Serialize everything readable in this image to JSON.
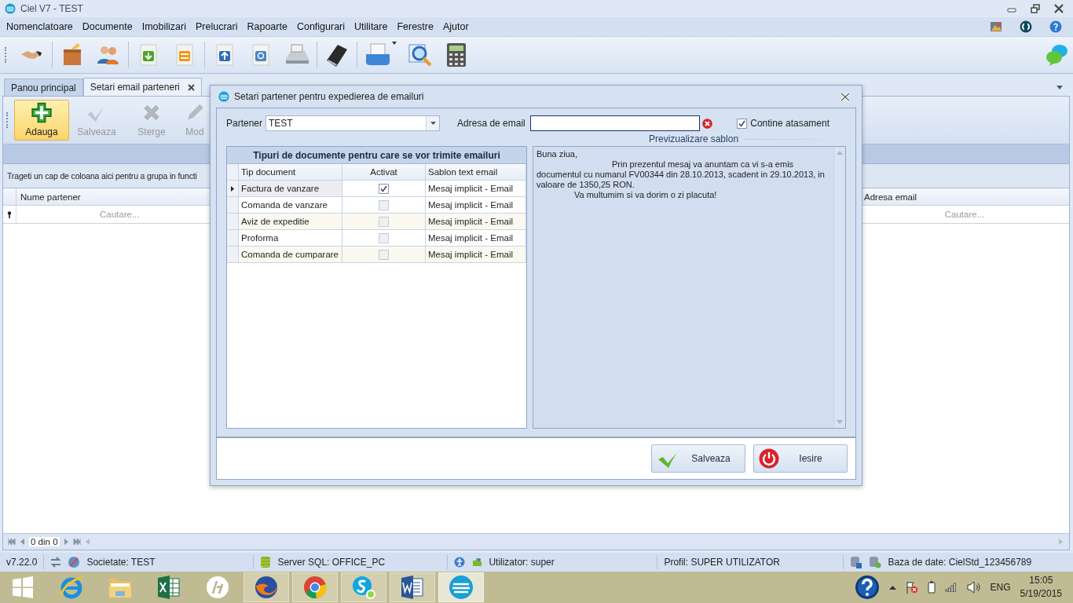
{
  "window": {
    "title": "Ciel V7 - TEST"
  },
  "menu": [
    "Nomenclatoare",
    "Documente",
    "Imobilizari",
    "Prelucrari",
    "Rapoarte",
    "Configurari",
    "Utilitare",
    "Ferestre",
    "Ajutor"
  ],
  "tabs": [
    {
      "label": "Panou principal",
      "selected": false
    },
    {
      "label": "Setari email parteneri",
      "selected": true
    }
  ],
  "ribbon": [
    {
      "label": "Adauga",
      "selected": true,
      "disabled": false
    },
    {
      "label": "Salveaza",
      "selected": false,
      "disabled": true
    },
    {
      "label": "Sterge",
      "selected": false,
      "disabled": true
    },
    {
      "label": "Mod",
      "selected": false,
      "disabled": true
    }
  ],
  "grid": {
    "group_hint": "Trageti un cap de coloana aici pentru a grupa in functi",
    "columns": [
      "Nume partener",
      "Adresa email"
    ],
    "filters": [
      "Cautare...",
      "Cautare..."
    ]
  },
  "pager": {
    "text": "0 din 0"
  },
  "dialog": {
    "title": "Setari partener pentru expedierea de emailuri",
    "partner": {
      "label": "Partener",
      "value": "TEST"
    },
    "email": {
      "label": "Adresa de email"
    },
    "attachment": {
      "label": "Contine atasament",
      "checked": true
    },
    "preview_label": "Previzualizare sablon",
    "table": {
      "title": "Tipuri de documente pentru care se vor trimite emailuri",
      "columns": [
        "Tip document",
        "Activat",
        "Sablon text email"
      ],
      "rows": [
        {
          "type": "Factura de vanzare",
          "active": true,
          "template": "Mesaj implicit - Email",
          "selected": true
        },
        {
          "type": "Comanda de vanzare",
          "active": false,
          "template": "Mesaj implicit - Email",
          "selected": false
        },
        {
          "type": "Aviz de expeditie",
          "active": false,
          "template": "Mesaj implicit - Email",
          "selected": false
        },
        {
          "type": "Proforma",
          "active": false,
          "template": "Mesaj implicit - Email",
          "selected": false
        },
        {
          "type": "Comanda de cumparare",
          "active": false,
          "template": "Mesaj implicit - Email",
          "selected": false
        }
      ]
    },
    "preview": [
      {
        "kind": "greeting",
        "text": "Buna ziua,"
      },
      {
        "kind": "body",
        "text": "Prin prezentul mesaj va anuntam ca vi s-a emis documentul cu numarul FV00344 din 28.10.2013, scadent in 29.10.2013, in valoare de 1350,25 RON."
      },
      {
        "kind": "closing",
        "text": "Va multumim si va dorim o zi placuta!"
      }
    ],
    "buttons": [
      {
        "kind": "save",
        "label": "Salveaza"
      },
      {
        "kind": "exit",
        "label": "Iesire"
      }
    ]
  },
  "status_bar": {
    "version": "v7.22.0",
    "company": "Societate: TEST",
    "server": "Server SQL: OFFICE_PC",
    "user": "Utilizator: super",
    "profile": "Profil: SUPER UTILIZATOR",
    "database": "Baza de date: CielStd_123456789"
  },
  "taskbar": {
    "apps": [
      {
        "open": false,
        "active": false
      },
      {
        "open": false,
        "active": false
      },
      {
        "open": false,
        "active": false
      },
      {
        "open": false,
        "active": false
      },
      {
        "open": false,
        "active": false
      },
      {
        "open": true,
        "active": false
      },
      {
        "open": true,
        "active": false
      },
      {
        "open": true,
        "active": false
      },
      {
        "open": true,
        "active": false
      },
      {
        "open": true,
        "active": true
      }
    ],
    "language": "ENG",
    "time": "15:05",
    "date": "5/19/2015"
  }
}
